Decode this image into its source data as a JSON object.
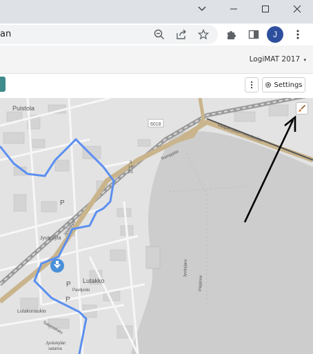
{
  "browser": {
    "address_text": "an",
    "profile_initial": "J"
  },
  "app": {
    "event_selector": "LogiMAT 2017",
    "settings_label": "Settings"
  },
  "map": {
    "labels": {
      "puistola": "Puistola",
      "road_6018": "6018",
      "vaajakoski_motorway": "Vaajakosken moottoritie",
      "ramp": "Ramppitie",
      "junction_9": "9",
      "junction_18": "18",
      "junction_23": "23",
      "p1": "P",
      "p2": "P",
      "p3": "P",
      "jyvaskyla": "Jyväskylä",
      "lutakko": "Lutakko",
      "paviljonki": "Paviljonki",
      "lutakonaukio": "Lutakonaukio",
      "satamakatu": "Satamakatu",
      "jyvaskylan_satama_1": "Jyväskylän",
      "jyvaskylan_satama_2": "satama",
      "lake_1": "Jyväsjärvi",
      "lake_2": "Päijänne",
      "rail": "Jyväskylä"
    }
  },
  "colors": {
    "route": "#5b8ff0",
    "marker": "#4a90d9",
    "teal": "#3e8b8b",
    "water": "#cdcdcd",
    "land": "#e3e3e3",
    "motorway": "#c9b48c"
  },
  "icons": {
    "minimize": "minimize-icon",
    "maximize": "maximize-icon",
    "close": "close-icon",
    "zoom": "zoom-out-icon",
    "share": "share-icon",
    "star": "star-icon",
    "extensions": "puzzle-icon",
    "sidepanel": "side-panel-icon",
    "menu": "kebab-icon",
    "gear": "gear-icon",
    "brush": "paint-brush-icon",
    "location": "location-pin-icon"
  }
}
